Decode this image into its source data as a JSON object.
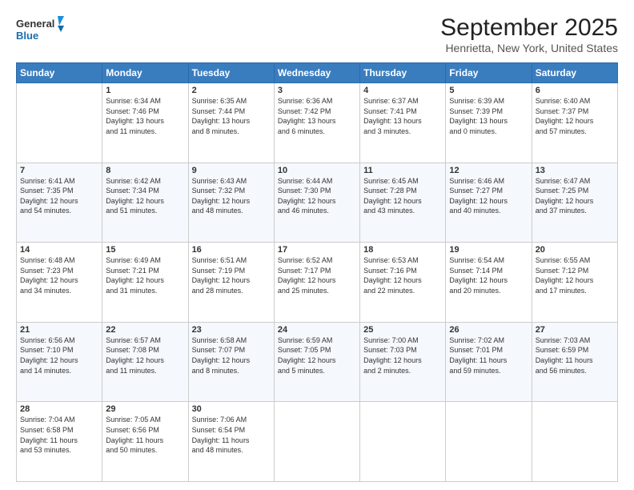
{
  "logo": {
    "line1": "General",
    "line2": "Blue"
  },
  "title": "September 2025",
  "subtitle": "Henrietta, New York, United States",
  "days_header": [
    "Sunday",
    "Monday",
    "Tuesday",
    "Wednesday",
    "Thursday",
    "Friday",
    "Saturday"
  ],
  "weeks": [
    [
      {
        "day": "",
        "info": ""
      },
      {
        "day": "1",
        "info": "Sunrise: 6:34 AM\nSunset: 7:46 PM\nDaylight: 13 hours\nand 11 minutes."
      },
      {
        "day": "2",
        "info": "Sunrise: 6:35 AM\nSunset: 7:44 PM\nDaylight: 13 hours\nand 8 minutes."
      },
      {
        "day": "3",
        "info": "Sunrise: 6:36 AM\nSunset: 7:42 PM\nDaylight: 13 hours\nand 6 minutes."
      },
      {
        "day": "4",
        "info": "Sunrise: 6:37 AM\nSunset: 7:41 PM\nDaylight: 13 hours\nand 3 minutes."
      },
      {
        "day": "5",
        "info": "Sunrise: 6:39 AM\nSunset: 7:39 PM\nDaylight: 13 hours\nand 0 minutes."
      },
      {
        "day": "6",
        "info": "Sunrise: 6:40 AM\nSunset: 7:37 PM\nDaylight: 12 hours\nand 57 minutes."
      }
    ],
    [
      {
        "day": "7",
        "info": "Sunrise: 6:41 AM\nSunset: 7:35 PM\nDaylight: 12 hours\nand 54 minutes."
      },
      {
        "day": "8",
        "info": "Sunrise: 6:42 AM\nSunset: 7:34 PM\nDaylight: 12 hours\nand 51 minutes."
      },
      {
        "day": "9",
        "info": "Sunrise: 6:43 AM\nSunset: 7:32 PM\nDaylight: 12 hours\nand 48 minutes."
      },
      {
        "day": "10",
        "info": "Sunrise: 6:44 AM\nSunset: 7:30 PM\nDaylight: 12 hours\nand 46 minutes."
      },
      {
        "day": "11",
        "info": "Sunrise: 6:45 AM\nSunset: 7:28 PM\nDaylight: 12 hours\nand 43 minutes."
      },
      {
        "day": "12",
        "info": "Sunrise: 6:46 AM\nSunset: 7:27 PM\nDaylight: 12 hours\nand 40 minutes."
      },
      {
        "day": "13",
        "info": "Sunrise: 6:47 AM\nSunset: 7:25 PM\nDaylight: 12 hours\nand 37 minutes."
      }
    ],
    [
      {
        "day": "14",
        "info": "Sunrise: 6:48 AM\nSunset: 7:23 PM\nDaylight: 12 hours\nand 34 minutes."
      },
      {
        "day": "15",
        "info": "Sunrise: 6:49 AM\nSunset: 7:21 PM\nDaylight: 12 hours\nand 31 minutes."
      },
      {
        "day": "16",
        "info": "Sunrise: 6:51 AM\nSunset: 7:19 PM\nDaylight: 12 hours\nand 28 minutes."
      },
      {
        "day": "17",
        "info": "Sunrise: 6:52 AM\nSunset: 7:17 PM\nDaylight: 12 hours\nand 25 minutes."
      },
      {
        "day": "18",
        "info": "Sunrise: 6:53 AM\nSunset: 7:16 PM\nDaylight: 12 hours\nand 22 minutes."
      },
      {
        "day": "19",
        "info": "Sunrise: 6:54 AM\nSunset: 7:14 PM\nDaylight: 12 hours\nand 20 minutes."
      },
      {
        "day": "20",
        "info": "Sunrise: 6:55 AM\nSunset: 7:12 PM\nDaylight: 12 hours\nand 17 minutes."
      }
    ],
    [
      {
        "day": "21",
        "info": "Sunrise: 6:56 AM\nSunset: 7:10 PM\nDaylight: 12 hours\nand 14 minutes."
      },
      {
        "day": "22",
        "info": "Sunrise: 6:57 AM\nSunset: 7:08 PM\nDaylight: 12 hours\nand 11 minutes."
      },
      {
        "day": "23",
        "info": "Sunrise: 6:58 AM\nSunset: 7:07 PM\nDaylight: 12 hours\nand 8 minutes."
      },
      {
        "day": "24",
        "info": "Sunrise: 6:59 AM\nSunset: 7:05 PM\nDaylight: 12 hours\nand 5 minutes."
      },
      {
        "day": "25",
        "info": "Sunrise: 7:00 AM\nSunset: 7:03 PM\nDaylight: 12 hours\nand 2 minutes."
      },
      {
        "day": "26",
        "info": "Sunrise: 7:02 AM\nSunset: 7:01 PM\nDaylight: 11 hours\nand 59 minutes."
      },
      {
        "day": "27",
        "info": "Sunrise: 7:03 AM\nSunset: 6:59 PM\nDaylight: 11 hours\nand 56 minutes."
      }
    ],
    [
      {
        "day": "28",
        "info": "Sunrise: 7:04 AM\nSunset: 6:58 PM\nDaylight: 11 hours\nand 53 minutes."
      },
      {
        "day": "29",
        "info": "Sunrise: 7:05 AM\nSunset: 6:56 PM\nDaylight: 11 hours\nand 50 minutes."
      },
      {
        "day": "30",
        "info": "Sunrise: 7:06 AM\nSunset: 6:54 PM\nDaylight: 11 hours\nand 48 minutes."
      },
      {
        "day": "",
        "info": ""
      },
      {
        "day": "",
        "info": ""
      },
      {
        "day": "",
        "info": ""
      },
      {
        "day": "",
        "info": ""
      }
    ]
  ]
}
